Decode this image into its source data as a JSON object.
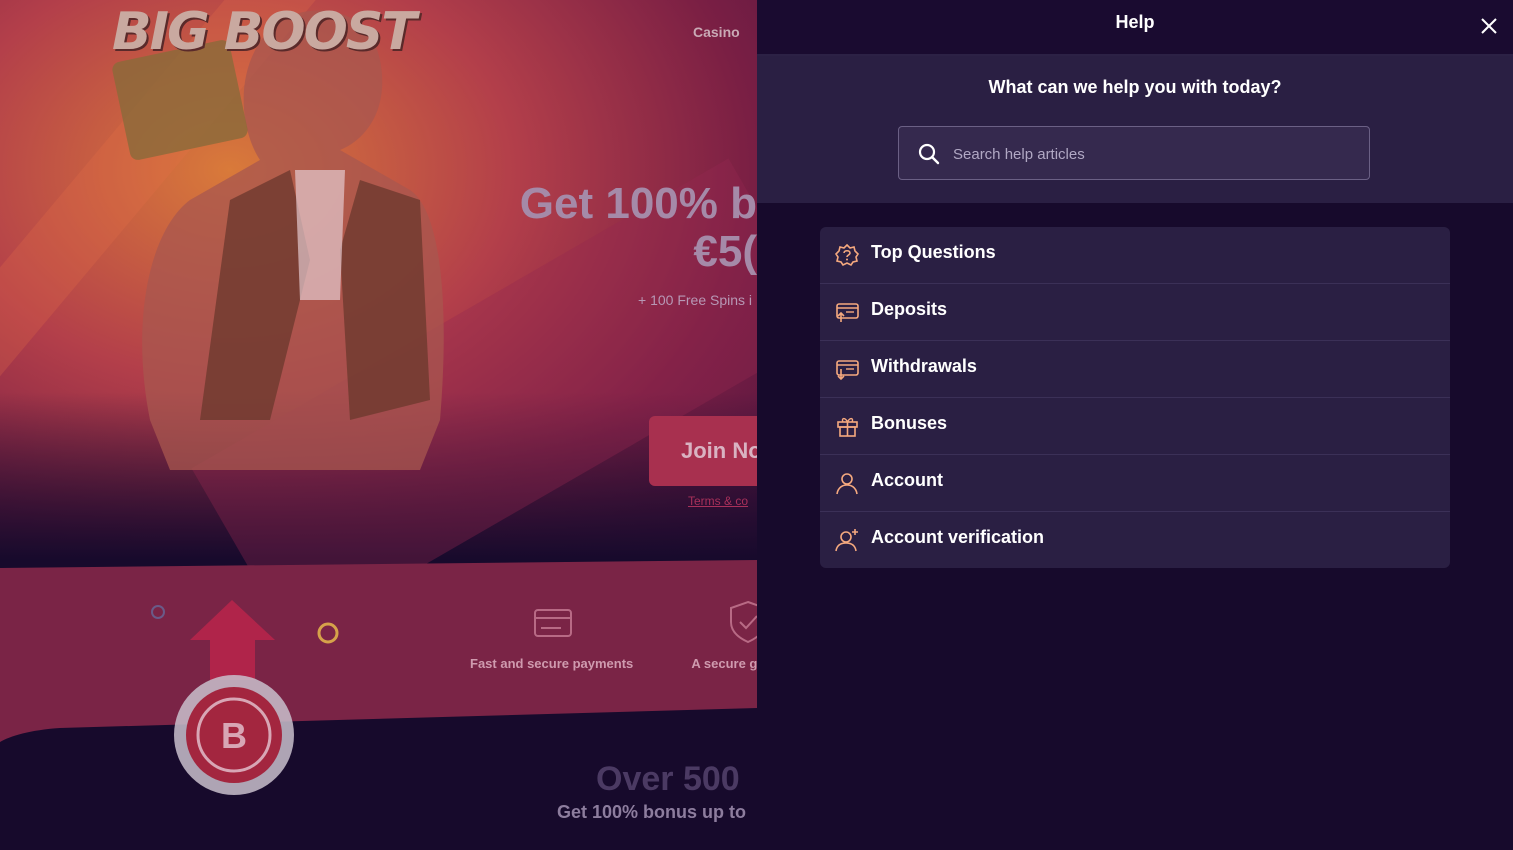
{
  "background_page": {
    "logo_text": "BIG BOOST",
    "nav_casino": "Casino",
    "hero_title_line1": "Get 100% b",
    "hero_title_line2": "€5(",
    "hero_subtitle": "+ 100 Free Spins i",
    "join_button": "Join No",
    "terms_link": "Terms & co",
    "feature_1": "Fast and secure payments",
    "feature_2": "A secure ga",
    "bottom_heading": "Over 500",
    "bottom_subheading": "Get 100% bonus up to"
  },
  "help_panel": {
    "title": "Help",
    "close_icon": "close-icon",
    "search_heading": "What can we help you with today?",
    "search_placeholder": "Search help articles",
    "search_icon": "search-icon",
    "accent_icon_color": "#f5a97f",
    "topics": [
      {
        "label": "Top Questions",
        "icon": "question-badge-icon"
      },
      {
        "label": "Deposits",
        "icon": "deposit-icon"
      },
      {
        "label": "Withdrawals",
        "icon": "withdrawal-icon"
      },
      {
        "label": "Bonuses",
        "icon": "gift-icon"
      },
      {
        "label": "Account",
        "icon": "user-icon"
      },
      {
        "label": "Account verification",
        "icon": "user-verified-icon"
      }
    ]
  }
}
